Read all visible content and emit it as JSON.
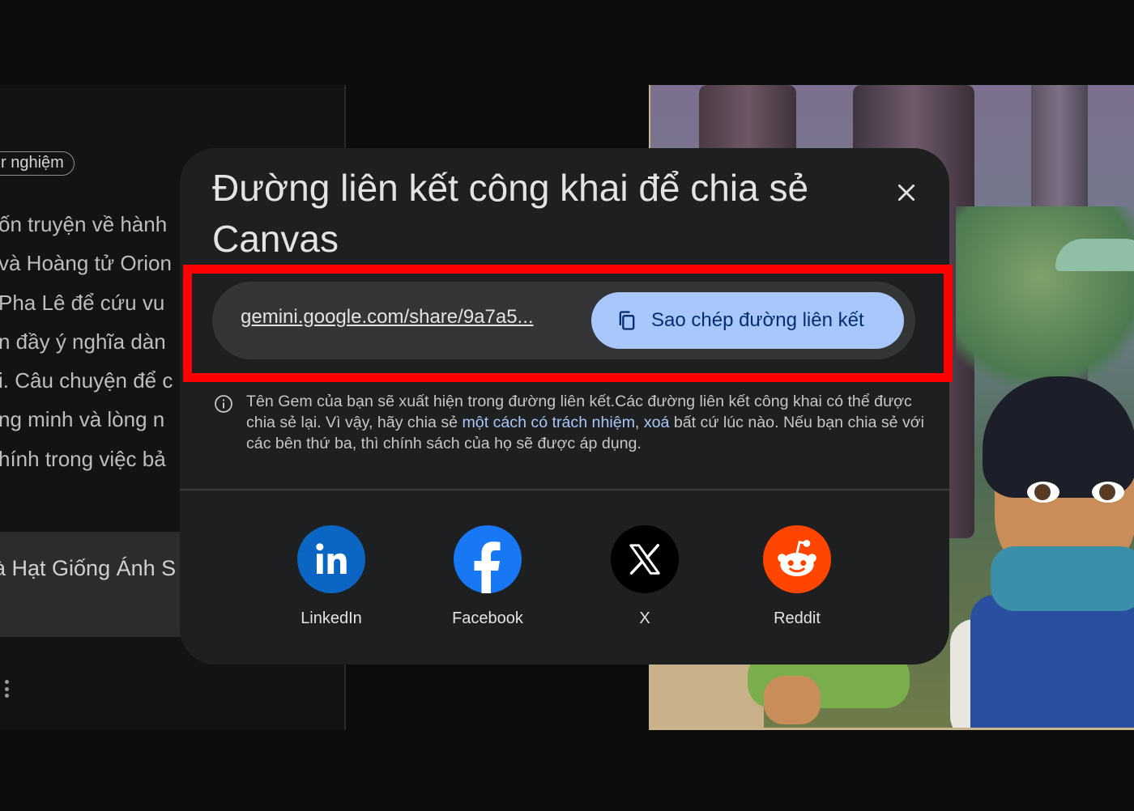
{
  "background": {
    "left_panel": {
      "chip_label": "r nghiệm",
      "story_lines": [
        "ốn truyện về hành",
        "và Hoàng tử Orion",
        " Pha Lê để cứu vu",
        "n đầy ý nghĩa dàn",
        "i. Câu chuyện để c",
        "ng minh và lòng n",
        "hính trong việc bả"
      ],
      "bookmark_title": "à Hạt Giống Ánh S"
    }
  },
  "dialog": {
    "title": "Đường liên kết công khai để chia sẻ Canvas",
    "link": {
      "url": "gemini.google.com/share/9a7a5...",
      "copy_label": "Sao chép đường liên kết"
    },
    "info": {
      "part1": "Tên Gem của bạn sẽ xuất hiện trong đường liên kết.Các đường liên kết công khai có thể được chia sẻ lại. Vì vậy, hãy chia sẻ ",
      "link1": "một cách có trách nhiệm",
      "sep": ", ",
      "link2": "xoá",
      "part2": " bất cứ lúc nào. Nếu bạn chia sẻ với các bên thứ ba, thì chính sách của họ sẽ được áp dụng."
    },
    "share_targets": [
      {
        "label": "LinkedIn",
        "icon": "linkedin-icon",
        "color": "#0a66c2"
      },
      {
        "label": "Facebook",
        "icon": "facebook-icon",
        "color": "#1877f2"
      },
      {
        "label": "X",
        "icon": "x-icon",
        "color": "#000000"
      },
      {
        "label": "Reddit",
        "icon": "reddit-icon",
        "color": "#ff4500"
      }
    ]
  },
  "colors": {
    "dialog_bg": "#1e1f20",
    "copy_button": "#a8c7fa",
    "highlight": "#ff0000",
    "link": "#a8c7fa"
  }
}
